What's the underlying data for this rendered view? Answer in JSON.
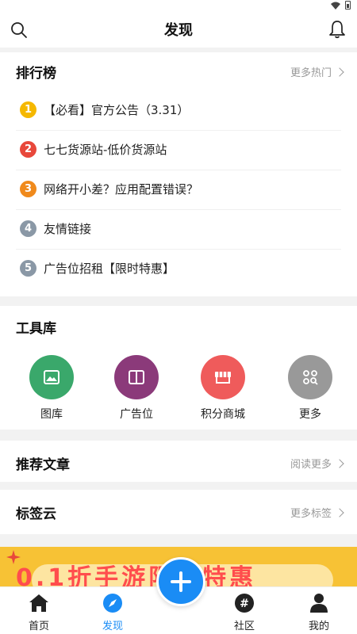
{
  "header": {
    "title": "发现"
  },
  "ranking": {
    "title": "排行榜",
    "more": "更多热门",
    "items": [
      {
        "num": "1",
        "text": "【必看】官方公告（3.31）",
        "color": "#f5b800"
      },
      {
        "num": "2",
        "text": "七七货源站-低价货源站",
        "color": "#e8483b"
      },
      {
        "num": "3",
        "text": "网络开小差？应用配置错误？",
        "color": "#f08a1c"
      },
      {
        "num": "4",
        "text": "友情链接",
        "color": "#8a98a6"
      },
      {
        "num": "5",
        "text": "广告位招租【限时特惠】",
        "color": "#8a98a6"
      }
    ]
  },
  "tools": {
    "title": "工具库",
    "items": [
      {
        "label": "图库",
        "color": "#3aa86b",
        "icon": "image-icon"
      },
      {
        "label": "广告位",
        "color": "#8b3a7a",
        "icon": "book-icon"
      },
      {
        "label": "积分商城",
        "color": "#ef5b5b",
        "icon": "store-icon"
      },
      {
        "label": "更多",
        "color": "#999999",
        "icon": "grid-search-icon"
      }
    ]
  },
  "articles": {
    "title": "推荐文章",
    "more": "阅读更多"
  },
  "tags": {
    "title": "标签云",
    "more": "更多标签"
  },
  "banner": {
    "text": "0.1折手游限时特惠"
  },
  "tabbar": {
    "items": [
      {
        "label": "首页",
        "icon": "home-icon"
      },
      {
        "label": "发现",
        "icon": "compass-icon",
        "active": true
      },
      {
        "label": "社区",
        "icon": "hashtag-icon"
      },
      {
        "label": "我的",
        "icon": "user-icon"
      }
    ]
  },
  "colors": {
    "accent": "#1a8cf5"
  }
}
